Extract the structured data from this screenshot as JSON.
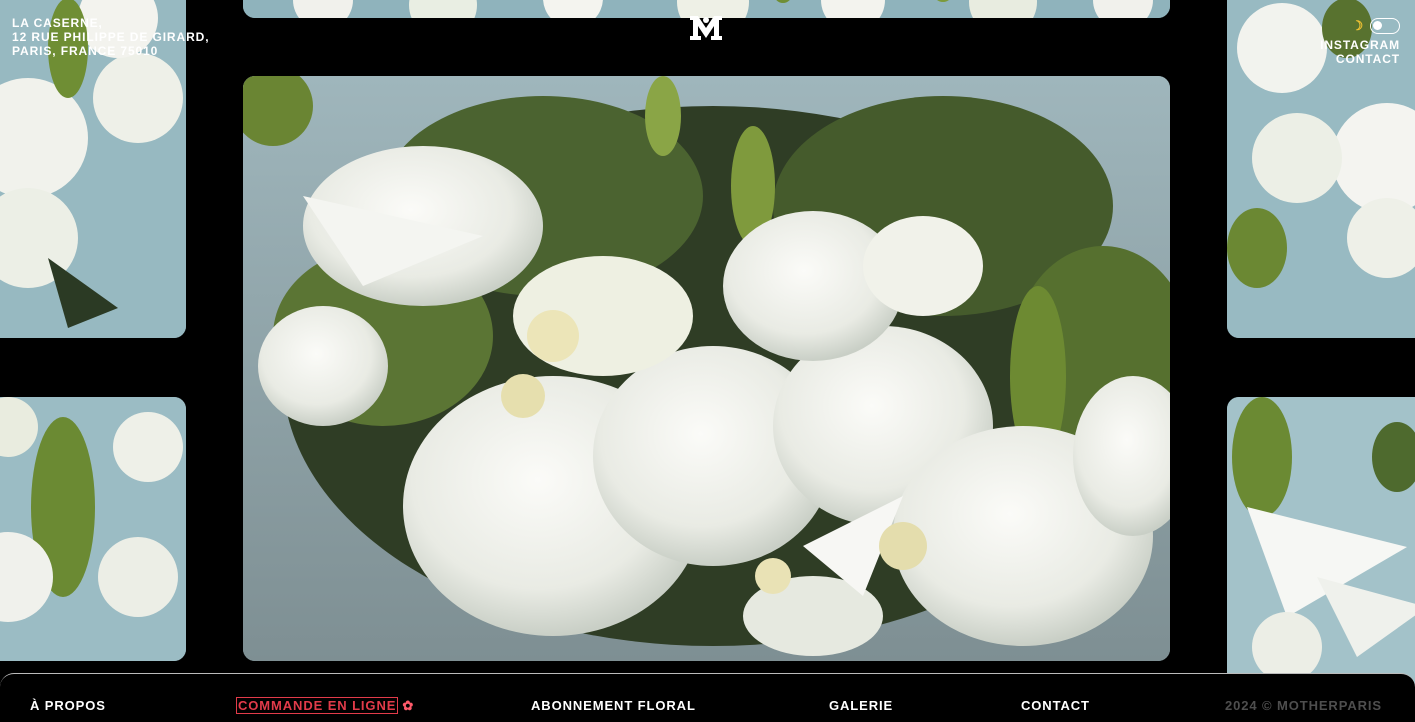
{
  "header": {
    "address_lines": [
      "LA CASERNE,",
      "12 RUE PHILIPPE DE GIRARD,",
      "PARIS, FRANCE 75010"
    ],
    "logo_icon": "m-monogram-icon",
    "theme_icon": "moon-icon",
    "links": {
      "instagram": "INSTAGRAM",
      "contact": "CONTACT"
    }
  },
  "gallery": {
    "images": [
      "white-bouquet-main",
      "white-bouquet-left-top",
      "white-bouquet-left-bottom",
      "white-bouquet-right-top",
      "white-bouquet-right-bottom",
      "white-bouquet-top"
    ]
  },
  "footer": {
    "apropos": "À PROPOS",
    "commande": "COMMANDE EN LIGNE",
    "commande_icon": "flower-icon",
    "abonnement": "ABONNEMENT FLORAL",
    "galerie": "GALERIE",
    "contact": "CONTACT",
    "copyright": "2024 © MOTHERPARIS"
  },
  "colors": {
    "background": "#000000",
    "accent": "#e23b4a",
    "muted": "#4e4e4e"
  }
}
